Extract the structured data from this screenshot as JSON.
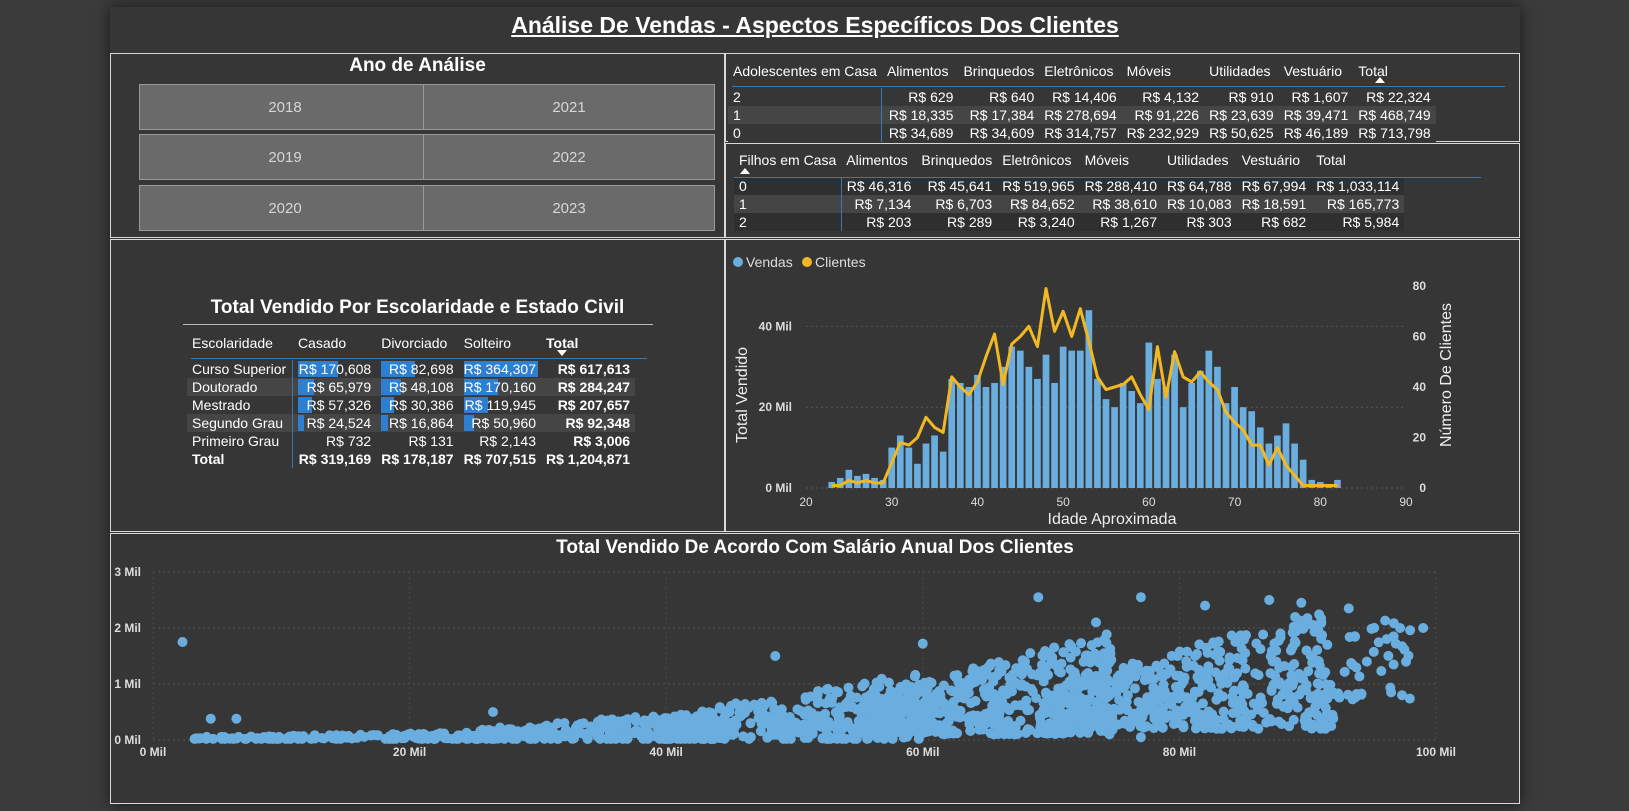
{
  "title": "Análise De Vendas - Aspectos Específicos Dos Clientes",
  "colors": {
    "sales": "#6aaee0",
    "clients": "#f2b824",
    "bar_highlight": "#2f7fd0"
  },
  "slicer": {
    "title": "Ano de Análise",
    "years": [
      "2018",
      "2021",
      "2019",
      "2022",
      "2020",
      "2023"
    ]
  },
  "teens_table": {
    "row_header": "Adolescentes em Casa",
    "columns": [
      "Alimentos",
      "Brinquedos",
      "Eletrônicos",
      "Móveis",
      "Utilidades",
      "Vestuário",
      "Total"
    ],
    "rows": [
      {
        "label": "2",
        "values": [
          "R$ 629",
          "R$ 640",
          "R$ 14,406",
          "R$ 4,132",
          "R$ 910",
          "R$ 1,607",
          "R$ 22,324"
        ]
      },
      {
        "label": "1",
        "values": [
          "R$ 18,335",
          "R$ 17,384",
          "R$ 278,694",
          "R$ 91,226",
          "R$ 23,639",
          "R$ 39,471",
          "R$ 468,749"
        ]
      },
      {
        "label": "0",
        "values": [
          "R$ 34,689",
          "R$ 34,609",
          "R$ 314,757",
          "R$ 232,929",
          "R$ 50,625",
          "R$ 46,189",
          "R$ 713,798"
        ]
      }
    ]
  },
  "kids_table": {
    "row_header": "Filhos em Casa",
    "columns": [
      "Alimentos",
      "Brinquedos",
      "Eletrônicos",
      "Móveis",
      "Utilidades",
      "Vestuário",
      "Total"
    ],
    "rows": [
      {
        "label": "0",
        "values": [
          "R$ 46,316",
          "R$ 45,641",
          "R$ 519,965",
          "R$ 288,410",
          "R$ 64,788",
          "R$ 67,994",
          "R$ 1,033,114"
        ]
      },
      {
        "label": "1",
        "values": [
          "R$ 7,134",
          "R$ 6,703",
          "R$ 84,652",
          "R$ 38,610",
          "R$ 10,083",
          "R$ 18,591",
          "R$ 165,773"
        ]
      },
      {
        "label": "2",
        "values": [
          "R$ 203",
          "R$ 289",
          "R$ 3,240",
          "R$ 1,267",
          "R$ 303",
          "R$ 682",
          "R$ 5,984"
        ]
      }
    ]
  },
  "education_table": {
    "title": "Total Vendido Por Escolaridade e Estado Civil",
    "row_header": "Escolaridade",
    "columns": [
      "Casado",
      "Divorciado",
      "Solteiro",
      "Total"
    ],
    "rows": [
      {
        "label": "Curso Superior",
        "values": [
          "R$ 170,608",
          "R$ 82,698",
          "R$ 364,307",
          "R$ 617,613"
        ],
        "fracs": [
          0.54,
          0.46,
          1.0
        ]
      },
      {
        "label": "Doutorado",
        "values": [
          "R$ 65,979",
          "R$ 48,108",
          "R$ 170,160",
          "R$ 284,247"
        ],
        "fracs": [
          0.21,
          0.27,
          0.47
        ]
      },
      {
        "label": "Mestrado",
        "values": [
          "R$ 57,326",
          "R$ 30,386",
          "R$ 119,945",
          "R$ 207,657"
        ],
        "fracs": [
          0.18,
          0.17,
          0.33
        ]
      },
      {
        "label": "Segundo Grau",
        "values": [
          "R$ 24,524",
          "R$ 16,864",
          "R$ 50,960",
          "R$ 92,348"
        ],
        "fracs": [
          0.08,
          0.09,
          0.14
        ]
      },
      {
        "label": "Primeiro Grau",
        "values": [
          "R$ 732",
          "R$ 131",
          "R$ 2,143",
          "R$ 3,006"
        ],
        "fracs": [
          0.0,
          0.0,
          0.0
        ]
      }
    ],
    "total_row": {
      "label": "Total",
      "values": [
        "R$ 319,169",
        "R$ 178,187",
        "R$ 707,515",
        "R$ 1,204,871"
      ]
    }
  },
  "chart_data": [
    {
      "type": "bar",
      "legend": [
        "Vendas",
        "Clientes"
      ],
      "legend_position": "top-left",
      "xlabel": "Idade Aproximada",
      "ylabel": "Total Vendido",
      "y2label": "Número De Clientes",
      "xlim": [
        20,
        90
      ],
      "ylim": [
        0,
        50
      ],
      "y2lim": [
        0,
        80
      ],
      "xticks": [
        "20",
        "30",
        "40",
        "50",
        "60",
        "70",
        "80",
        "90"
      ],
      "yticks": [
        "0 Mil",
        "20 Mil",
        "40 Mil"
      ],
      "y2ticks": [
        "0",
        "20",
        "40",
        "60",
        "80"
      ],
      "series": [
        {
          "name": "Vendas",
          "kind": "bar",
          "x": [
            23,
            24,
            25,
            26,
            27,
            28,
            29,
            30,
            31,
            32,
            33,
            34,
            35,
            36,
            37,
            38,
            39,
            40,
            41,
            42,
            43,
            44,
            45,
            46,
            47,
            48,
            49,
            50,
            51,
            52,
            53,
            54,
            55,
            56,
            57,
            58,
            59,
            60,
            61,
            62,
            63,
            64,
            65,
            66,
            67,
            68,
            69,
            70,
            71,
            72,
            73,
            74,
            75,
            76,
            77,
            78,
            79,
            80,
            81,
            82
          ],
          "values": [
            1.5,
            2.5,
            4.5,
            3,
            3.5,
            2.5,
            2,
            10,
            13,
            10,
            6,
            11,
            13,
            9,
            27,
            26,
            25,
            28,
            25,
            26,
            30,
            35,
            34,
            30,
            27,
            33,
            26,
            35,
            34,
            34,
            44,
            27,
            22,
            20,
            26,
            24,
            21,
            36,
            27,
            25,
            33,
            20,
            26,
            29,
            34,
            30,
            21,
            25,
            20,
            19,
            15,
            11,
            13,
            16,
            11,
            7,
            2,
            1.5,
            1,
            2
          ]
        },
        {
          "name": "Clientes",
          "kind": "line",
          "x": [
            23,
            24,
            25,
            26,
            27,
            28,
            29,
            30,
            31,
            32,
            33,
            34,
            35,
            36,
            37,
            38,
            39,
            40,
            41,
            42,
            43,
            44,
            45,
            46,
            47,
            48,
            49,
            50,
            51,
            52,
            53,
            54,
            55,
            56,
            57,
            58,
            59,
            60,
            61,
            62,
            63,
            64,
            65,
            66,
            67,
            68,
            69,
            70,
            71,
            72,
            73,
            74,
            75,
            76,
            77,
            78,
            79,
            80,
            81,
            82
          ],
          "values": [
            1,
            1,
            3,
            2,
            3,
            2,
            2,
            10,
            18,
            17,
            20,
            28,
            24,
            22,
            44,
            40,
            37,
            42,
            52,
            61,
            41,
            57,
            60,
            64,
            56,
            79,
            62,
            70,
            60,
            71,
            58,
            44,
            39,
            40,
            41,
            44,
            37,
            31,
            56,
            36,
            54,
            44,
            42,
            46,
            42,
            39,
            30,
            26,
            23,
            17,
            17,
            9,
            16,
            9,
            5,
            1,
            1,
            1,
            1,
            1
          ]
        }
      ]
    },
    {
      "type": "scatter",
      "title": "Total Vendido De Acordo Com Salário Anual Dos Clientes",
      "xlim": [
        0,
        100
      ],
      "ylim": [
        0,
        3
      ],
      "xticks": [
        "0 Mil",
        "20 Mil",
        "40 Mil",
        "60 Mil",
        "80 Mil",
        "100 Mil"
      ],
      "yticks": [
        "0 Mil",
        "1 Mil",
        "2 Mil",
        "3 Mil"
      ],
      "notable_points": [
        {
          "x": 2.3,
          "y": 1.75
        },
        {
          "x": 4.5,
          "y": 0.38
        },
        {
          "x": 6.5,
          "y": 0.38
        },
        {
          "x": 26.5,
          "y": 0.5
        },
        {
          "x": 48.5,
          "y": 1.5
        },
        {
          "x": 60,
          "y": 1.72
        },
        {
          "x": 69,
          "y": 2.55
        },
        {
          "x": 73.5,
          "y": 2.1
        },
        {
          "x": 77,
          "y": 2.55
        },
        {
          "x": 82,
          "y": 2.4
        },
        {
          "x": 87,
          "y": 2.5
        },
        {
          "x": 89.5,
          "y": 2.45
        },
        {
          "x": 93.2,
          "y": 2.35
        },
        {
          "x": 97.2,
          "y": 2.0
        },
        {
          "x": 99,
          "y": 2.0
        },
        {
          "x": 96.5,
          "y": 0.85
        },
        {
          "x": 77,
          "y": 0.05
        }
      ],
      "cloud": [
        {
          "x0": 3,
          "x1": 30,
          "ymin": 0,
          "ymax": 0.15,
          "count": 150
        },
        {
          "x0": 25,
          "x1": 45,
          "ymin": 0,
          "ymax": 0.55,
          "count": 240
        },
        {
          "x0": 40,
          "x1": 60,
          "ymin": 0,
          "ymax": 1.25,
          "count": 360
        },
        {
          "x0": 55,
          "x1": 75,
          "ymin": 0.1,
          "ymax": 1.95,
          "count": 480
        },
        {
          "x0": 70,
          "x1": 92,
          "ymin": 0.2,
          "ymax": 2.4,
          "count": 460
        },
        {
          "x0": 88,
          "x1": 98,
          "ymin": 0.7,
          "ymax": 2.35,
          "count": 60
        }
      ]
    }
  ]
}
